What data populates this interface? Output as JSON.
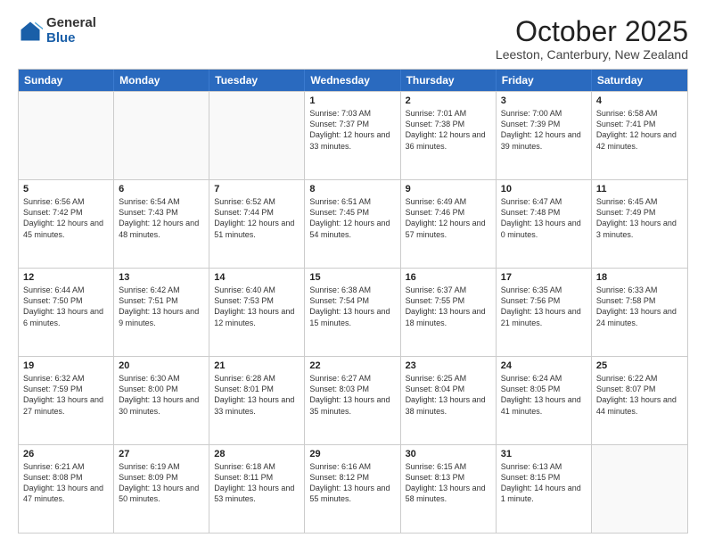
{
  "logo": {
    "general": "General",
    "blue": "Blue"
  },
  "header": {
    "title": "October 2025",
    "subtitle": "Leeston, Canterbury, New Zealand"
  },
  "days_of_week": [
    "Sunday",
    "Monday",
    "Tuesday",
    "Wednesday",
    "Thursday",
    "Friday",
    "Saturday"
  ],
  "weeks": [
    [
      {
        "day": "",
        "info": ""
      },
      {
        "day": "",
        "info": ""
      },
      {
        "day": "",
        "info": ""
      },
      {
        "day": "1",
        "info": "Sunrise: 7:03 AM\nSunset: 7:37 PM\nDaylight: 12 hours\nand 33 minutes."
      },
      {
        "day": "2",
        "info": "Sunrise: 7:01 AM\nSunset: 7:38 PM\nDaylight: 12 hours\nand 36 minutes."
      },
      {
        "day": "3",
        "info": "Sunrise: 7:00 AM\nSunset: 7:39 PM\nDaylight: 12 hours\nand 39 minutes."
      },
      {
        "day": "4",
        "info": "Sunrise: 6:58 AM\nSunset: 7:41 PM\nDaylight: 12 hours\nand 42 minutes."
      }
    ],
    [
      {
        "day": "5",
        "info": "Sunrise: 6:56 AM\nSunset: 7:42 PM\nDaylight: 12 hours\nand 45 minutes."
      },
      {
        "day": "6",
        "info": "Sunrise: 6:54 AM\nSunset: 7:43 PM\nDaylight: 12 hours\nand 48 minutes."
      },
      {
        "day": "7",
        "info": "Sunrise: 6:52 AM\nSunset: 7:44 PM\nDaylight: 12 hours\nand 51 minutes."
      },
      {
        "day": "8",
        "info": "Sunrise: 6:51 AM\nSunset: 7:45 PM\nDaylight: 12 hours\nand 54 minutes."
      },
      {
        "day": "9",
        "info": "Sunrise: 6:49 AM\nSunset: 7:46 PM\nDaylight: 12 hours\nand 57 minutes."
      },
      {
        "day": "10",
        "info": "Sunrise: 6:47 AM\nSunset: 7:48 PM\nDaylight: 13 hours\nand 0 minutes."
      },
      {
        "day": "11",
        "info": "Sunrise: 6:45 AM\nSunset: 7:49 PM\nDaylight: 13 hours\nand 3 minutes."
      }
    ],
    [
      {
        "day": "12",
        "info": "Sunrise: 6:44 AM\nSunset: 7:50 PM\nDaylight: 13 hours\nand 6 minutes."
      },
      {
        "day": "13",
        "info": "Sunrise: 6:42 AM\nSunset: 7:51 PM\nDaylight: 13 hours\nand 9 minutes."
      },
      {
        "day": "14",
        "info": "Sunrise: 6:40 AM\nSunset: 7:53 PM\nDaylight: 13 hours\nand 12 minutes."
      },
      {
        "day": "15",
        "info": "Sunrise: 6:38 AM\nSunset: 7:54 PM\nDaylight: 13 hours\nand 15 minutes."
      },
      {
        "day": "16",
        "info": "Sunrise: 6:37 AM\nSunset: 7:55 PM\nDaylight: 13 hours\nand 18 minutes."
      },
      {
        "day": "17",
        "info": "Sunrise: 6:35 AM\nSunset: 7:56 PM\nDaylight: 13 hours\nand 21 minutes."
      },
      {
        "day": "18",
        "info": "Sunrise: 6:33 AM\nSunset: 7:58 PM\nDaylight: 13 hours\nand 24 minutes."
      }
    ],
    [
      {
        "day": "19",
        "info": "Sunrise: 6:32 AM\nSunset: 7:59 PM\nDaylight: 13 hours\nand 27 minutes."
      },
      {
        "day": "20",
        "info": "Sunrise: 6:30 AM\nSunset: 8:00 PM\nDaylight: 13 hours\nand 30 minutes."
      },
      {
        "day": "21",
        "info": "Sunrise: 6:28 AM\nSunset: 8:01 PM\nDaylight: 13 hours\nand 33 minutes."
      },
      {
        "day": "22",
        "info": "Sunrise: 6:27 AM\nSunset: 8:03 PM\nDaylight: 13 hours\nand 35 minutes."
      },
      {
        "day": "23",
        "info": "Sunrise: 6:25 AM\nSunset: 8:04 PM\nDaylight: 13 hours\nand 38 minutes."
      },
      {
        "day": "24",
        "info": "Sunrise: 6:24 AM\nSunset: 8:05 PM\nDaylight: 13 hours\nand 41 minutes."
      },
      {
        "day": "25",
        "info": "Sunrise: 6:22 AM\nSunset: 8:07 PM\nDaylight: 13 hours\nand 44 minutes."
      }
    ],
    [
      {
        "day": "26",
        "info": "Sunrise: 6:21 AM\nSunset: 8:08 PM\nDaylight: 13 hours\nand 47 minutes."
      },
      {
        "day": "27",
        "info": "Sunrise: 6:19 AM\nSunset: 8:09 PM\nDaylight: 13 hours\nand 50 minutes."
      },
      {
        "day": "28",
        "info": "Sunrise: 6:18 AM\nSunset: 8:11 PM\nDaylight: 13 hours\nand 53 minutes."
      },
      {
        "day": "29",
        "info": "Sunrise: 6:16 AM\nSunset: 8:12 PM\nDaylight: 13 hours\nand 55 minutes."
      },
      {
        "day": "30",
        "info": "Sunrise: 6:15 AM\nSunset: 8:13 PM\nDaylight: 13 hours\nand 58 minutes."
      },
      {
        "day": "31",
        "info": "Sunrise: 6:13 AM\nSunset: 8:15 PM\nDaylight: 14 hours\nand 1 minute."
      },
      {
        "day": "",
        "info": ""
      }
    ]
  ]
}
